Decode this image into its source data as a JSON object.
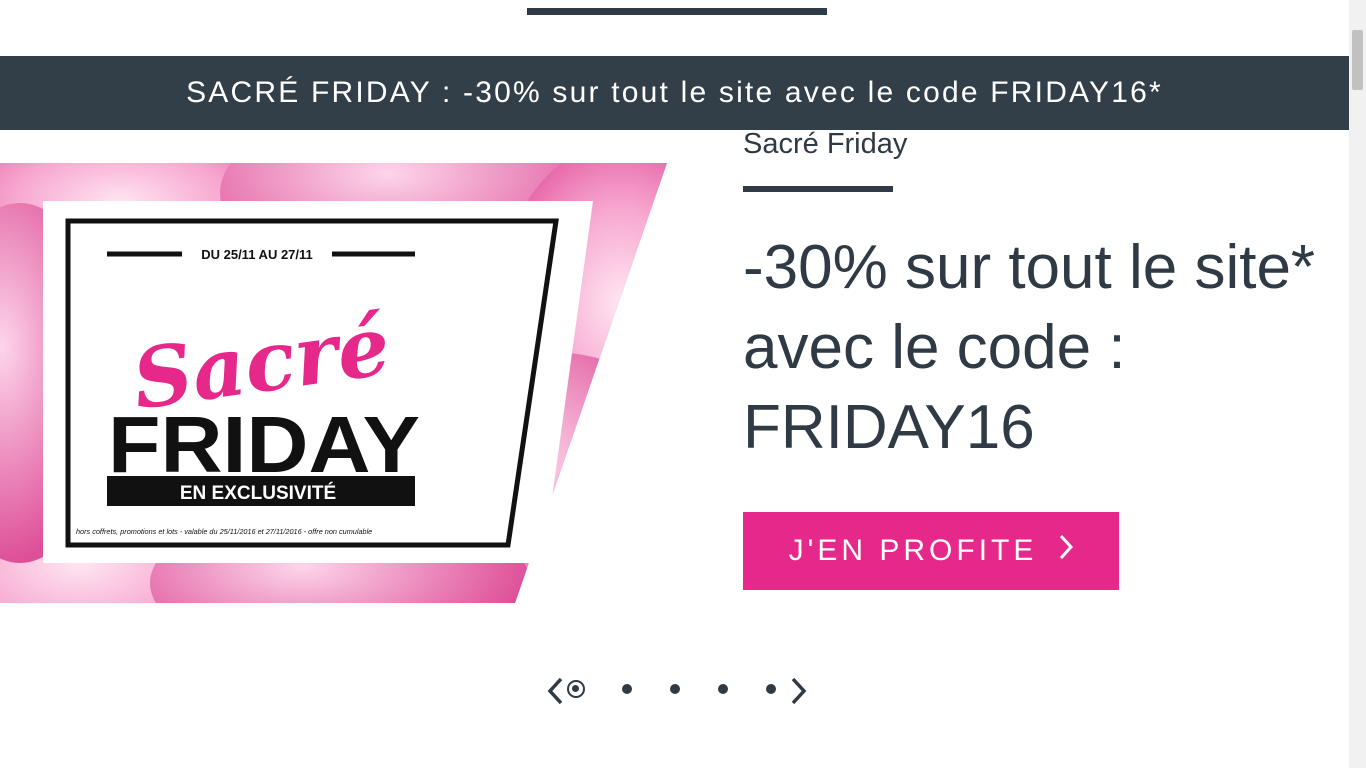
{
  "promo_bar": {
    "text": "SACRÉ FRIDAY : -30% sur tout le site avec le code FRIDAY16*"
  },
  "banner_image": {
    "dates": "DU 25/11 AU 27/11",
    "script_title": "Sacré",
    "title": "FRIDAY",
    "badge": "EN EXCLUSIVITÉ",
    "fine_print": "hors coffrets, promotions et lots - valable du 25/11/2016 et 27/11/2016 - offre non cumulable"
  },
  "slide": {
    "title": "Sacré Friday",
    "headline": "-30% sur tout le site* avec le code : FRIDAY16",
    "cta_label": "J'EN PROFITE"
  },
  "carousel": {
    "slides_count": 5,
    "active_index": 0
  },
  "colors": {
    "dark": "#323e48",
    "accent_pink": "#e5288a",
    "background": "#ffffff"
  }
}
